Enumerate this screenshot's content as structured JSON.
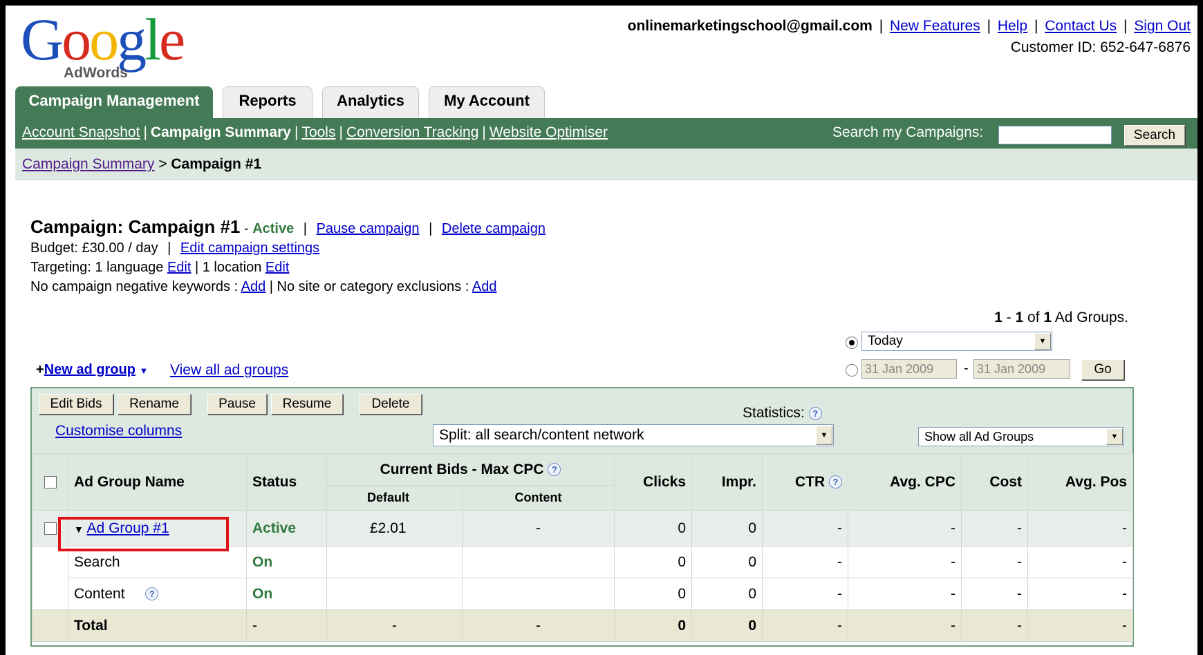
{
  "brand": {
    "logo_word": "Google",
    "logo_sub": "AdWords",
    "logo_colors": [
      "#1b4fba",
      "#d62b1e",
      "#f2b600",
      "#1b4fba",
      "#139b3a",
      "#d62b1e"
    ]
  },
  "top_links": {
    "email": "onlinemarketingschool@gmail.com",
    "links": [
      "New Features",
      "Help",
      "Contact Us",
      "Sign Out"
    ],
    "customer_id": "Customer ID: 652-647-6876"
  },
  "tabs": [
    "Campaign Management",
    "Reports",
    "Analytics",
    "My Account"
  ],
  "subnav": {
    "items": [
      "Account Snapshot",
      "Campaign Summary",
      "Tools",
      "Conversion Tracking",
      "Website Optimiser"
    ],
    "search_label": "Search my Campaigns:",
    "search_value": "",
    "search_button": "Search"
  },
  "breadcrumb": {
    "parent": "Campaign Summary",
    "separator": ">",
    "current": "Campaign #1"
  },
  "campaign": {
    "title": "Campaign: Campaign #1",
    "status_prefix": "-",
    "status": "Active",
    "pause": "Pause campaign",
    "delete": "Delete campaign",
    "budget": "Budget: £30.00 / day",
    "edit_settings": "Edit campaign settings",
    "targeting_1": "Targeting: 1 language",
    "edit": "Edit",
    "targeting_2": "| 1 location",
    "negatives": "No campaign negative keywords :",
    "add": "Add",
    "exclusions": "| No site or category exclusions :"
  },
  "ad_group_count": {
    "from": "1",
    "to": "1",
    "total": "1",
    "label": "Ad Groups."
  },
  "date_range": {
    "preset": "Today",
    "start": "31 Jan 2009",
    "end": "31 Jan 2009",
    "go": "Go"
  },
  "actions": {
    "new_ad_group": "New ad group",
    "view_all": "View all ad groups"
  },
  "toolbar": {
    "buttons": [
      "Edit Bids",
      "Rename",
      "Pause",
      "Resume",
      "Delete"
    ],
    "customise": "Customise columns",
    "statistics": "Statistics:",
    "split": "Split: all search/content network",
    "filter": "Show all Ad Groups"
  },
  "table": {
    "headers": {
      "name": "Ad Group Name",
      "status": "Status",
      "bids": "Current Bids - Max CPC",
      "default": "Default",
      "content": "Content",
      "clicks": "Clicks",
      "impr": "Impr.",
      "ctr": "CTR",
      "avg_cpc": "Avg. CPC",
      "cost": "Cost",
      "avg_pos": "Avg. Pos"
    },
    "rows": [
      {
        "name": "Ad Group #1",
        "status": "Active",
        "default": "£2.01",
        "content": "-",
        "clicks": "0",
        "impr": "0",
        "ctr": "-",
        "avg_cpc": "-",
        "cost": "-",
        "avg_pos": "-"
      },
      {
        "name": "Search",
        "status": "On",
        "default": "",
        "content": "",
        "clicks": "0",
        "impr": "0",
        "ctr": "-",
        "avg_cpc": "-",
        "cost": "-",
        "avg_pos": "-"
      },
      {
        "name": "Content",
        "status": "On",
        "default": "",
        "content": "",
        "clicks": "0",
        "impr": "0",
        "ctr": "-",
        "avg_cpc": "-",
        "cost": "-",
        "avg_pos": "-"
      },
      {
        "name": "Total",
        "status": "-",
        "default": "-",
        "content": "-",
        "clicks": "0",
        "impr": "0",
        "ctr": "-",
        "avg_cpc": "-",
        "cost": "-",
        "avg_pos": "-"
      }
    ]
  },
  "colors": {
    "nav_green": "#457a57",
    "light_green": "#dde9e0",
    "status_green": "#2f7a3d",
    "highlight_red": "#e1111a"
  }
}
